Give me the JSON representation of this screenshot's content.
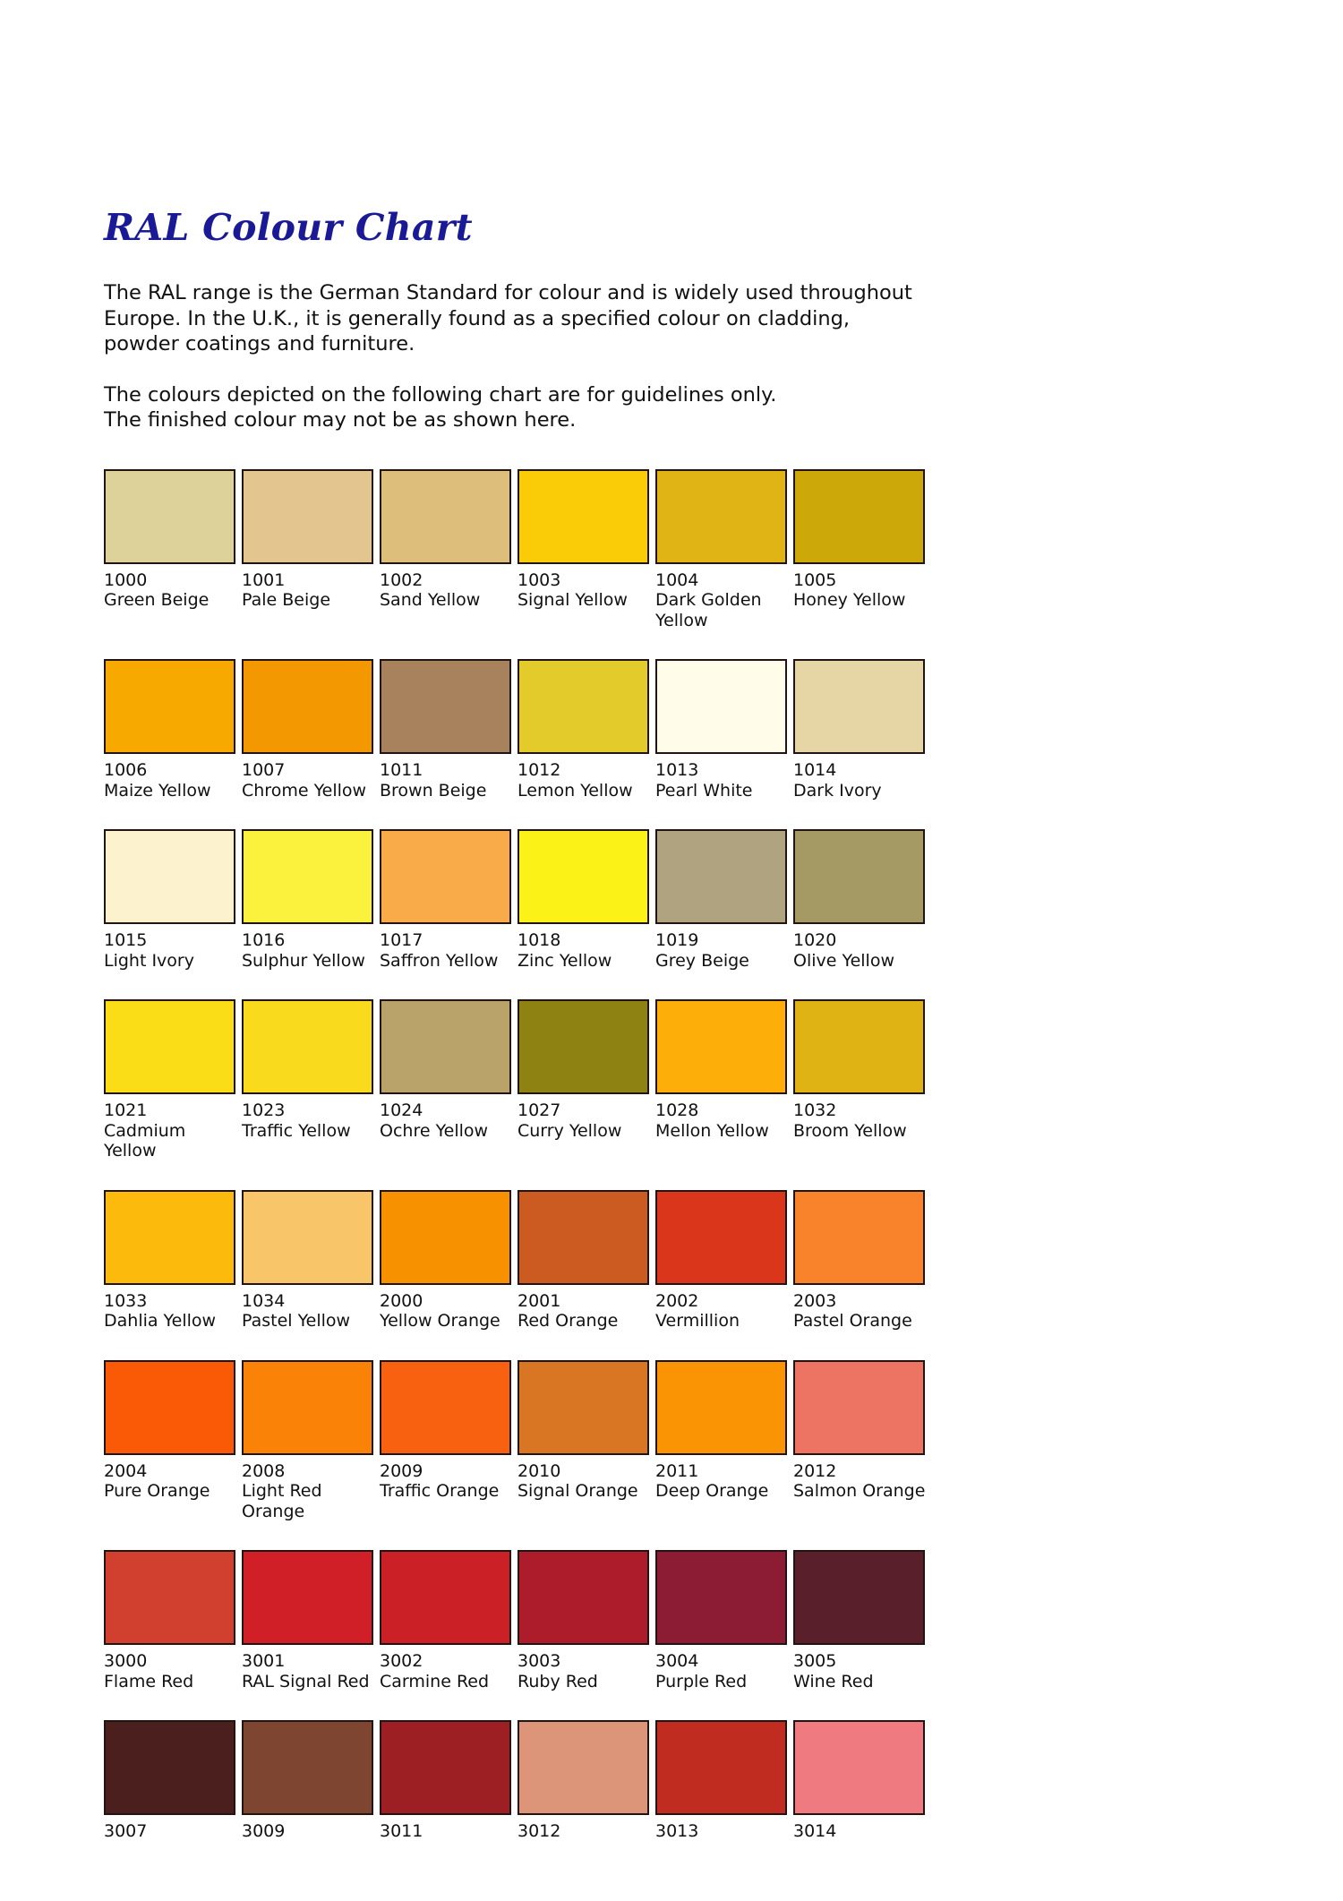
{
  "document": {
    "title": "RAL Colour Chart",
    "title_color": "#1a1a96",
    "background_color": "#ffffff",
    "text_color": "#111111"
  },
  "intro": {
    "paragraph1_line1": "The RAL range is the German Standard for colour and is widely used throughout",
    "paragraph1_line2": "Europe. In the U.K., it is generally found as a specified colour on cladding,",
    "paragraph1_line3": "powder coatings and furniture.",
    "paragraph2_line1": "The colours depicted on the following chart are for guidelines only.",
    "paragraph2_line2": "The finished colour may not be as shown here."
  },
  "chart_data": {
    "type": "table",
    "title": "RAL Colour Chart",
    "columns": 6,
    "rows": 8,
    "swatch_border_color": "#231414",
    "rows_data": [
      [
        {
          "code": "1000",
          "name": "Green Beige",
          "hex": "#ddd29a"
        },
        {
          "code": "1001",
          "name": "Pale Beige",
          "hex": "#e3c58f"
        },
        {
          "code": "1002",
          "name": "Sand Yellow",
          "hex": "#ddbe7a"
        },
        {
          "code": "1003",
          "name": "Signal Yellow",
          "hex": "#facb07"
        },
        {
          "code": "1004",
          "name": "Dark Golden Yellow",
          "hex": "#e0b414"
        },
        {
          "code": "1005",
          "name": "Honey Yellow",
          "hex": "#cca809"
        }
      ],
      [
        {
          "code": "1006",
          "name": "Maize Yellow",
          "hex": "#f8a900"
        },
        {
          "code": "1007",
          "name": "Chrome Yellow",
          "hex": "#f49800"
        },
        {
          "code": "1011",
          "name": "Brown Beige",
          "hex": "#a8825c"
        },
        {
          "code": "1012",
          "name": "Lemon Yellow",
          "hex": "#e2cb2a"
        },
        {
          "code": "1013",
          "name": "Pearl White",
          "hex": "#fffce9"
        },
        {
          "code": "1014",
          "name": "Dark Ivory",
          "hex": "#e6d6a6"
        }
      ],
      [
        {
          "code": "1015",
          "name": "Light Ivory",
          "hex": "#fcf2cd"
        },
        {
          "code": "1016",
          "name": "Sulphur Yellow",
          "hex": "#fbf23d"
        },
        {
          "code": "1017",
          "name": "Saffron Yellow",
          "hex": "#f8ab48"
        },
        {
          "code": "1018",
          "name": "Zinc Yellow",
          "hex": "#fbf218"
        },
        {
          "code": "1019",
          "name": "Grey Beige",
          "hex": "#afa380"
        },
        {
          "code": "1020",
          "name": "Olive Yellow",
          "hex": "#a59a64"
        }
      ],
      [
        {
          "code": "1021",
          "name": "Cadmium Yellow",
          "hex": "#fadd16"
        },
        {
          "code": "1023",
          "name": "Traffic Yellow",
          "hex": "#f9da1d"
        },
        {
          "code": "1024",
          "name": "Ochre Yellow",
          "hex": "#b9a36b"
        },
        {
          "code": "1027",
          "name": "Curry Yellow",
          "hex": "#8e8212"
        },
        {
          "code": "1028",
          "name": "Mellon Yellow",
          "hex": "#feae09"
        },
        {
          "code": "1032",
          "name": "Broom Yellow",
          "hex": "#e0b314"
        }
      ],
      [
        {
          "code": "1033",
          "name": "Dahlia Yellow",
          "hex": "#fbba0c"
        },
        {
          "code": "1034",
          "name": "Pastel Yellow",
          "hex": "#f8c569"
        },
        {
          "code": "2000",
          "name": "Yellow Orange",
          "hex": "#f79100"
        },
        {
          "code": "2001",
          "name": "Red Orange",
          "hex": "#cb5b21"
        },
        {
          "code": "2002",
          "name": "Vermillion",
          "hex": "#d9361c"
        },
        {
          "code": "2003",
          "name": "Pastel Orange",
          "hex": "#f9832b"
        }
      ],
      [
        {
          "code": "2004",
          "name": "Pure Orange",
          "hex": "#fa5a05"
        },
        {
          "code": "2008",
          "name": "Light Red Orange",
          "hex": "#fa8207"
        },
        {
          "code": "2009",
          "name": "Traffic Orange",
          "hex": "#f86110"
        },
        {
          "code": "2010",
          "name": "Signal Orange",
          "hex": "#d97623"
        },
        {
          "code": "2011",
          "name": "Deep Orange",
          "hex": "#fa9404"
        },
        {
          "code": "2012",
          "name": "Salmon Orange",
          "hex": "#ed7463"
        }
      ],
      [
        {
          "code": "3000",
          "name": "Flame Red",
          "hex": "#d1402e"
        },
        {
          "code": "3001",
          "name": "RAL Signal Red",
          "hex": "#d01f26"
        },
        {
          "code": "3002",
          "name": "Carmine Red",
          "hex": "#cc2027"
        },
        {
          "code": "3003",
          "name": "Ruby Red",
          "hex": "#ac1c2b"
        },
        {
          "code": "3004",
          "name": "Purple Red",
          "hex": "#8c1b34"
        },
        {
          "code": "3005",
          "name": "Wine Red",
          "hex": "#59202c"
        }
      ],
      [
        {
          "code": "3007",
          "name": "",
          "hex": "#4a1f1e"
        },
        {
          "code": "3009",
          "name": "",
          "hex": "#7e4630"
        },
        {
          "code": "3011",
          "name": "",
          "hex": "#9e1f23"
        },
        {
          "code": "3012",
          "name": "",
          "hex": "#dd9579"
        },
        {
          "code": "3013",
          "name": "",
          "hex": "#c02d20"
        },
        {
          "code": "3014",
          "name": "",
          "hex": "#ef7b81"
        }
      ]
    ]
  }
}
